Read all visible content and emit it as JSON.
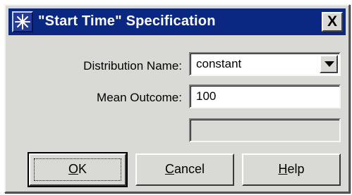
{
  "dialog": {
    "title": "\"Start Time\" Specification",
    "close_label": "X"
  },
  "form": {
    "distribution_label": "Distribution Name:",
    "distribution_value": "constant",
    "mean_label": "Mean Outcome:",
    "mean_value": "100",
    "extra_value": ""
  },
  "buttons": {
    "ok": {
      "mnemonic": "O",
      "rest": "K"
    },
    "cancel": {
      "mnemonic": "C",
      "rest": "ancel"
    },
    "help": {
      "mnemonic": "H",
      "rest": "elp"
    }
  },
  "icons": {
    "app": "star-burst-icon",
    "dropdown": "triangle-down-icon",
    "close": "close-icon"
  },
  "colors": {
    "titlebar": "#0a2781",
    "dialog_face": "#d9d9d5"
  }
}
